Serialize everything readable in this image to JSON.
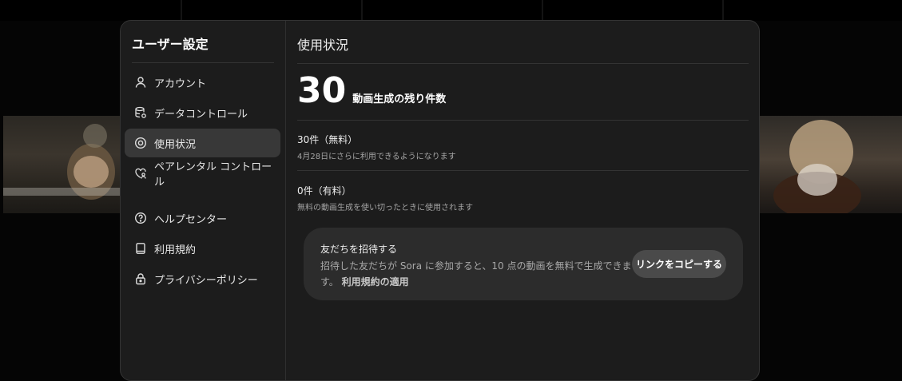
{
  "sidebar": {
    "title": "ユーザー設定",
    "items": [
      {
        "label": "アカウント",
        "icon": "user-icon",
        "active": false
      },
      {
        "label": "データコントロール",
        "icon": "database-icon",
        "active": false
      },
      {
        "label": "使用状況",
        "icon": "usage-icon",
        "active": true
      },
      {
        "label": "ペアレンタル コントロール",
        "icon": "heart-user-icon",
        "active": false
      },
      {
        "label": "ヘルプセンター",
        "icon": "help-icon",
        "active": false
      },
      {
        "label": "利用規約",
        "icon": "book-icon",
        "active": false
      },
      {
        "label": "プライバシーポリシー",
        "icon": "lock-icon",
        "active": false
      }
    ]
  },
  "usage": {
    "title": "使用状況",
    "remaining_count": "30",
    "remaining_label": "動画生成の残り件数",
    "free": {
      "title": "30件（無料）",
      "subtitle": "4月28日にさらに利用できるようになります"
    },
    "paid": {
      "title": "0件（有料）",
      "subtitle": "無料の動画生成を使い切ったときに使用されます"
    }
  },
  "invite": {
    "title": "友だちを招待する",
    "body": "招待した友だちが Sora に参加すると、10 点の動画を無料で生成できます。",
    "terms_link": "利用規約の適用",
    "button_label": "リンクをコピーする"
  },
  "colors": {
    "modal_bg": "#1c1c1c",
    "active_item_bg": "#383838",
    "invite_bg": "#2c2c2c",
    "button_bg": "#4a4a4a"
  }
}
